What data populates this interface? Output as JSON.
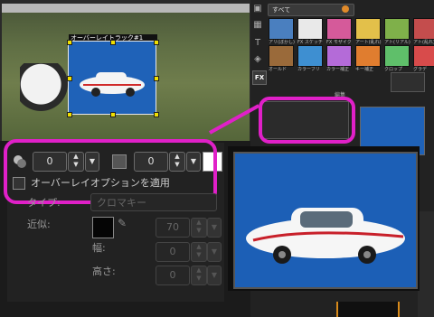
{
  "preview": {
    "overlay_label": "オーバーレイトラック#1"
  },
  "library": {
    "filter_label": "すべて",
    "section_label": "編集",
    "thumbnails": [
      {
        "label": "アリ(ぼかし)",
        "color": "#4a7fbf"
      },
      {
        "label": "FX スケッチ",
        "color": "#e9e9e9"
      },
      {
        "label": "FX モザイク",
        "color": "#d55a9a"
      },
      {
        "label": "アート(乱れ)",
        "color": "#e3c04a"
      },
      {
        "label": "アト(リアル)",
        "color": "#7fb04a"
      },
      {
        "label": "アト(乱れ)",
        "color": "#c44d4d"
      },
      {
        "label": "オールド",
        "color": "#9a6a3a"
      },
      {
        "label": "カラーフリ",
        "color": "#3e8fd1"
      },
      {
        "label": "カラー補正",
        "color": "#b46bd8"
      },
      {
        "label": "キー補正",
        "color": "#e07d2f"
      },
      {
        "label": "クロップ",
        "color": "#5fbf6a"
      },
      {
        "label": "グラデ",
        "color": "#d84b4b"
      }
    ]
  },
  "settings": {
    "spin1_value": "0",
    "spin2_value": "0",
    "overlay_checkbox_label": "オーバーレイオプションを適用",
    "type_label": "タイプ:",
    "type_value": "クロマキー",
    "similarity_label": "近似:",
    "similarity_value": "70",
    "width_label": "幅:",
    "width_value": "0",
    "height_label": "高さ:",
    "height_value": "0"
  },
  "colors": {
    "callout": "#e020c8",
    "blue_screen": "#1f62b8"
  }
}
